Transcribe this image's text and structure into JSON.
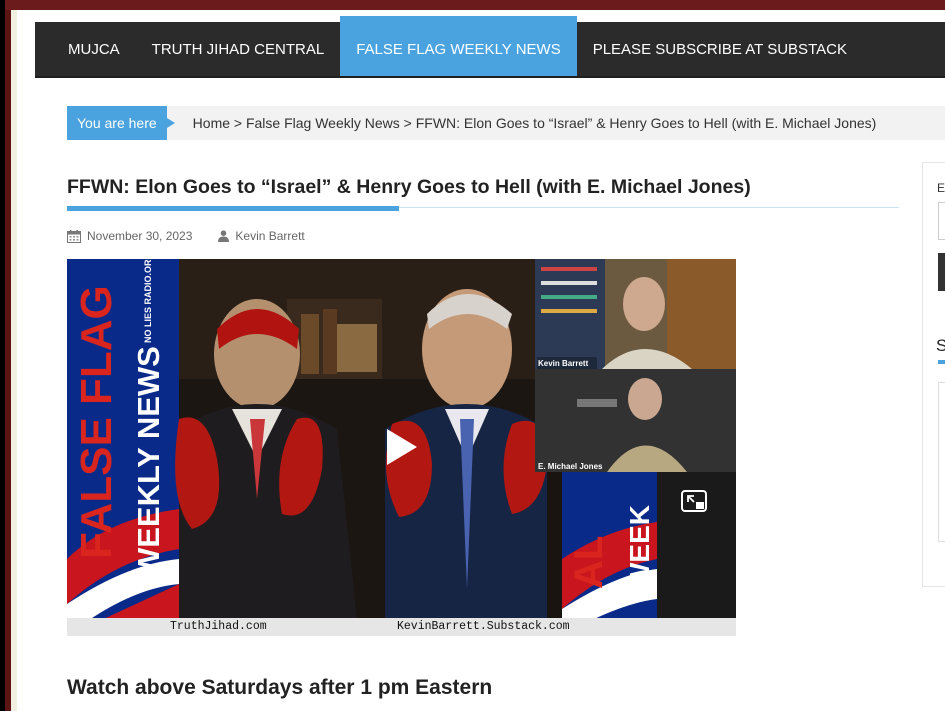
{
  "nav": {
    "items": [
      "MUJCA",
      "TRUTH JIHAD CENTRAL",
      "FALSE FLAG WEEKLY NEWS",
      "PLEASE SUBSCRIBE AT SUBSTACK"
    ],
    "active_index": 2
  },
  "breadcrumb": {
    "label": "You are here",
    "trail": "Home > False Flag Weekly News > FFWN: Elon Goes to “Israel” & Henry Goes to Hell (with E. Michael Jones)"
  },
  "post": {
    "title": "FFWN: Elon Goes to “Israel” & Henry Goes to Hell (with E. Michael Jones)",
    "date": "November 30, 2023",
    "author": "Kevin Barrett",
    "subheading": "Watch above Saturdays after 1 pm Eastern"
  },
  "video": {
    "logo_text_left": "FALSE FLAG",
    "logo_text_left2": "WEEKLY NEWS",
    "logo_badge": "NO LIES RADIO.ORG",
    "right_logo_1": "AL",
    "right_logo_2": "WEEK",
    "footer_left": "TruthJihad.com",
    "footer_right": "KevinBarrett.Substack.com",
    "caption_1": "Kevin Barrett",
    "caption_2": "E. Michael Jones",
    "icons": [
      "play-icon",
      "picture-in-picture-icon"
    ]
  },
  "sidebar": {
    "label_1": "E",
    "label_2": "S"
  },
  "colors": {
    "accent": "#4aa3df",
    "nav_bg": "#2b2b2b",
    "frame": "#6b1b1b"
  }
}
